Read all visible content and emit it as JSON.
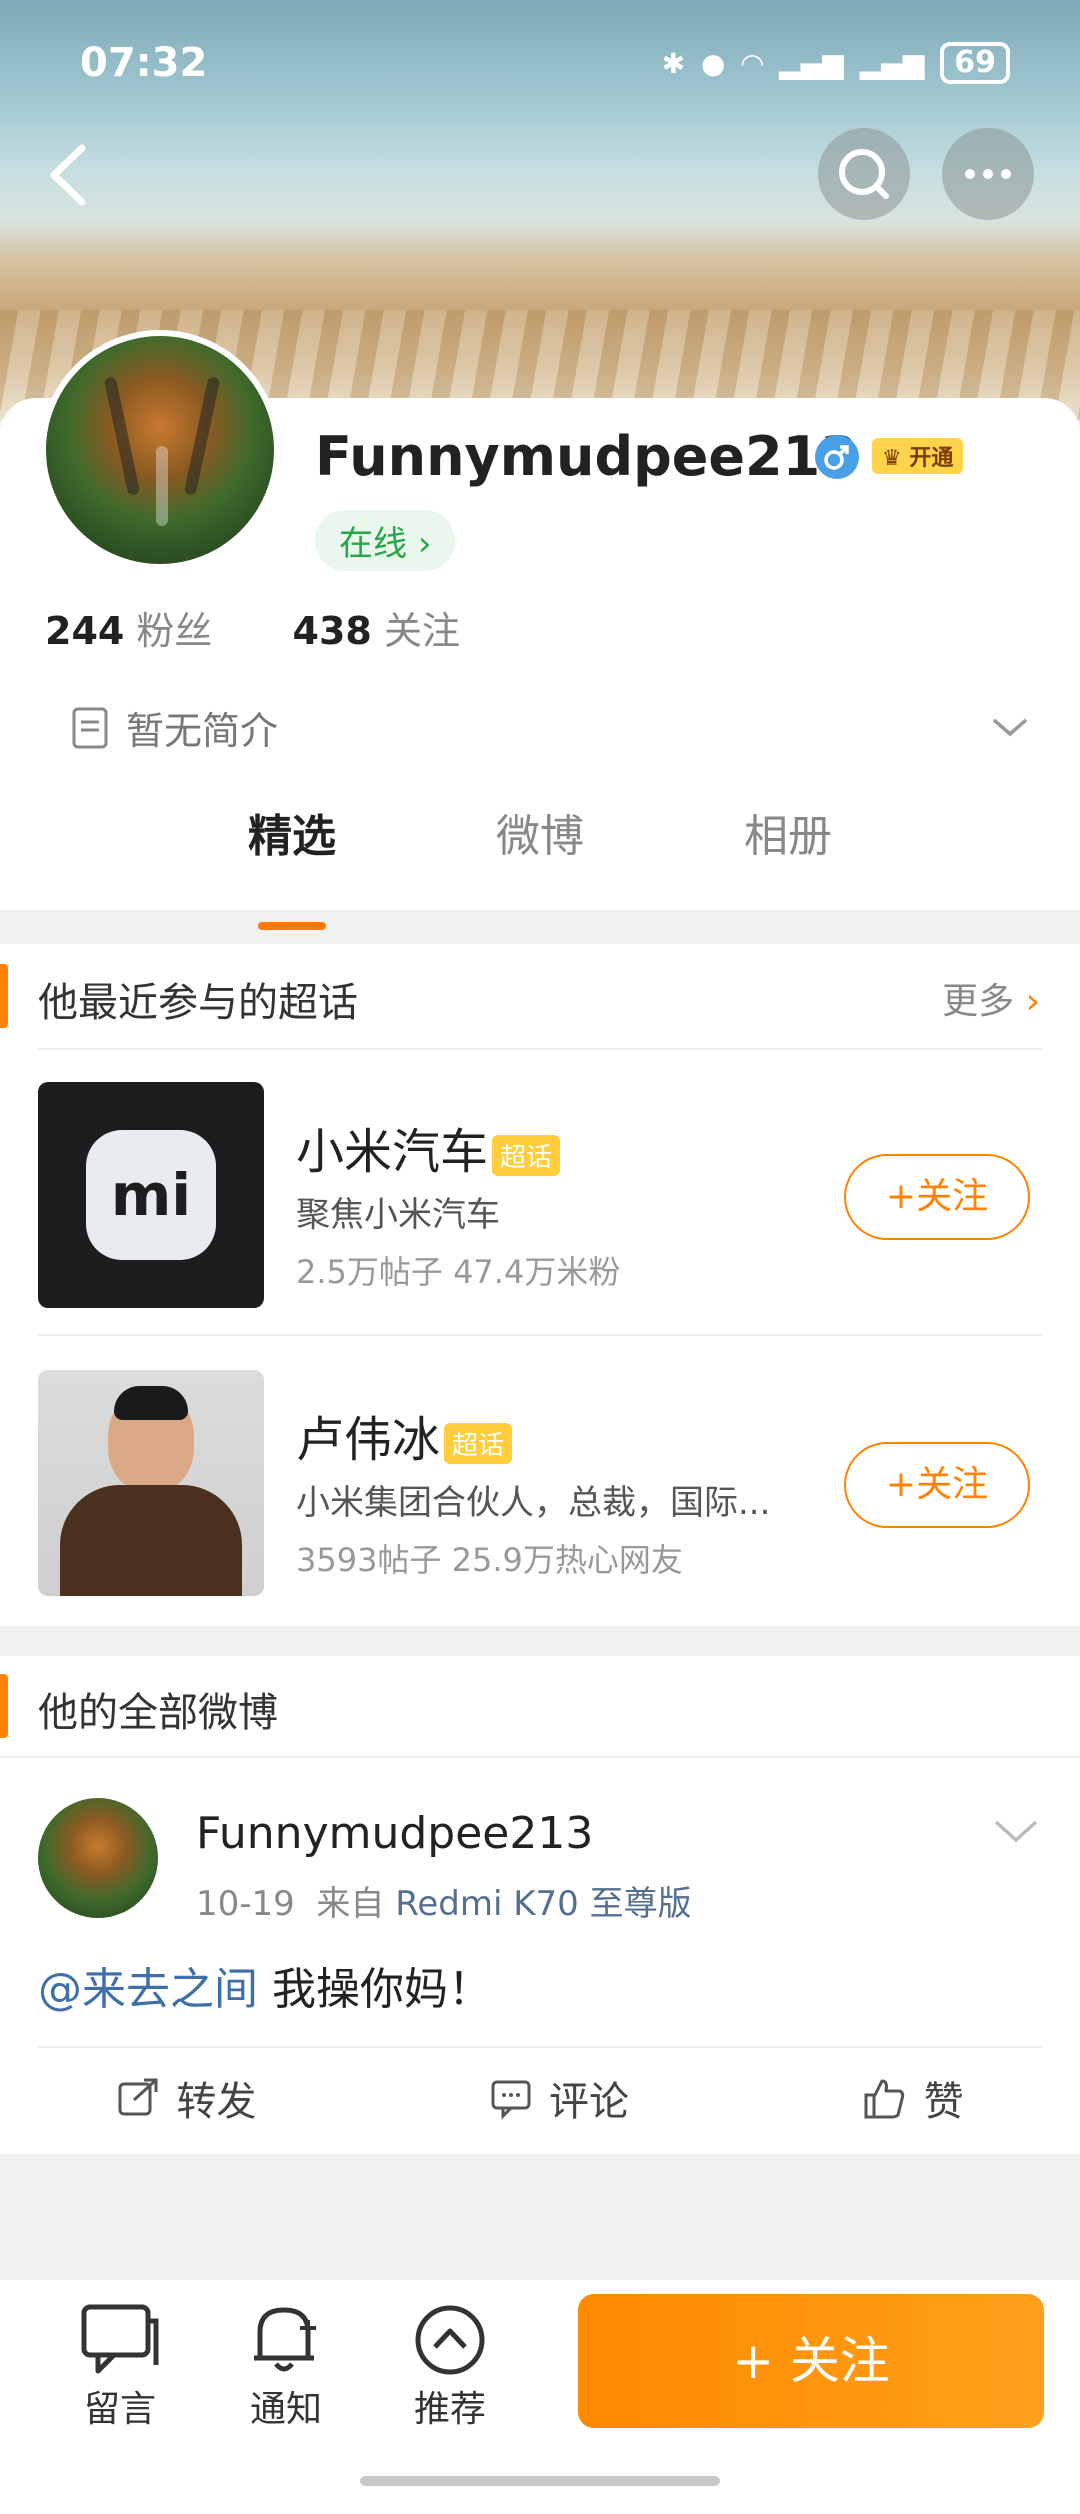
{
  "status_bar": {
    "time": "07:32",
    "battery": "69"
  },
  "profile": {
    "username": "Funnymudpee213",
    "vip_label": "开通",
    "online_label": "在线",
    "online_chevron": "›",
    "fans_count": "244",
    "fans_label": "粉丝",
    "following_count": "438",
    "following_label": "关注",
    "bio": "暂无简介"
  },
  "tabs": [
    {
      "label": "精选",
      "active": true
    },
    {
      "label": "微博",
      "active": false
    },
    {
      "label": "相册",
      "active": false
    }
  ],
  "super_topics": {
    "title": "他最近参与的超话",
    "more_label": "更多",
    "more_chevron": "›",
    "items": [
      {
        "name": "小米汽车",
        "badge": "超话",
        "desc": "聚焦小米汽车",
        "meta": "2.5万帖子 47.4万米粉",
        "follow_label": "+关注"
      },
      {
        "name": "卢伟冰",
        "badge": "超话",
        "desc": "小米集团合伙人，总裁，国际...",
        "meta": "3593帖子 25.9万热心网友",
        "follow_label": "+关注"
      }
    ]
  },
  "all_posts": {
    "title": "他的全部微博",
    "post": {
      "user": "Funnymudpee213",
      "date": "10-19",
      "source_prefix": "来自",
      "source": "Redmi K70 至尊版",
      "mention": "@来去之间",
      "text": " 我操你妈！",
      "actions": {
        "repost": "转发",
        "comment": "评论",
        "like": "赞"
      }
    }
  },
  "bottom_bar": {
    "message": "留言",
    "notify": "通知",
    "recommend": "推荐",
    "follow": "+ 关注"
  },
  "colors": {
    "accent": "#ff8200",
    "online_green": "#27a648",
    "link_blue": "#3f6fa8"
  }
}
